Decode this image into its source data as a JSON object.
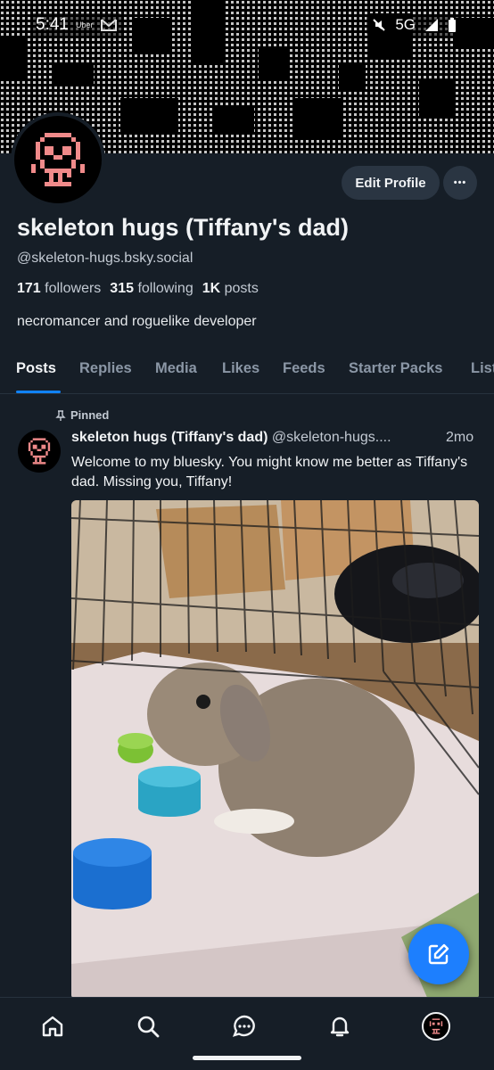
{
  "status_bar": {
    "time": "5:41",
    "left_extras": "Uber",
    "network": "5G"
  },
  "profile": {
    "edit_label": "Edit Profile",
    "more_label": "•••",
    "display_name": "skeleton hugs (Tiffany's dad)",
    "handle": "@skeleton-hugs.bsky.social",
    "followers_count": "171",
    "followers_label": "followers",
    "following_count": "315",
    "following_label": "following",
    "posts_count": "1K",
    "posts_label": "posts",
    "bio": "necromancer and roguelike developer"
  },
  "tabs": [
    {
      "label": "Posts"
    },
    {
      "label": "Replies"
    },
    {
      "label": "Media"
    },
    {
      "label": "Likes"
    },
    {
      "label": "Feeds"
    },
    {
      "label": "Starter Packs"
    },
    {
      "label": "Lists"
    }
  ],
  "post": {
    "pinned_label": "Pinned",
    "author": "skeleton hugs (Tiffany's dad)",
    "handle": "@skeleton-hugs....",
    "time": "2mo",
    "text": "Welcome to my bluesky. You might know me better as Tiffany's dad. Missing you, Tiffany!"
  },
  "colors": {
    "background": "#161e27",
    "accent": "#1083fe",
    "avatar_pink": "#f08a8a"
  }
}
